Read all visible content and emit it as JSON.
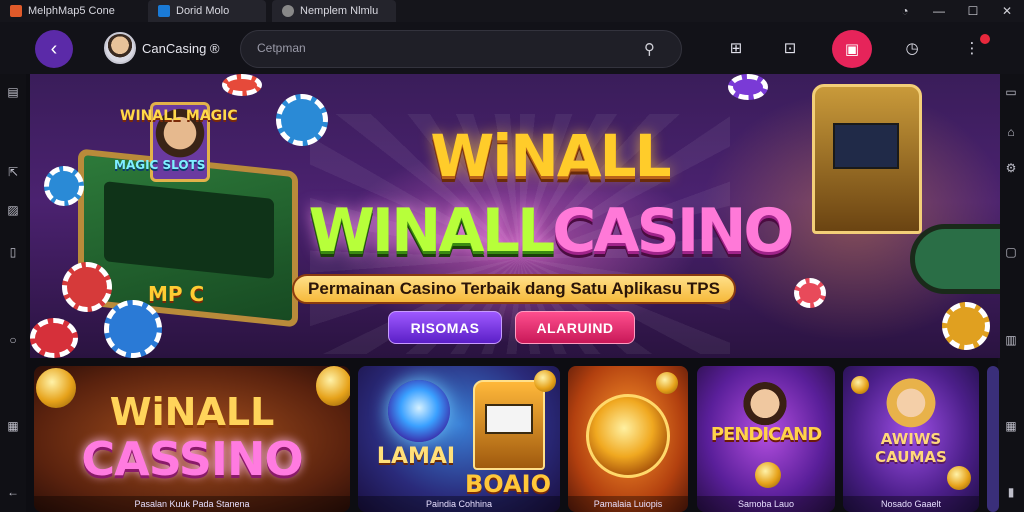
{
  "window": {
    "tabs": [
      {
        "label": "MelphMap5 Cone"
      },
      {
        "label": "Dorid   Molo"
      },
      {
        "label": "Nemplem Nlmlu"
      }
    ],
    "controls": [
      "◔",
      "—",
      "☐",
      "✕"
    ]
  },
  "toolbar": {
    "profile_name": "CanCasing ®",
    "search_placeholder": "Cetpman",
    "icons": [
      "back-icon",
      "search-icon",
      "plus-box-icon",
      "zoom-icon",
      "gift-icon",
      "timer-icon",
      "more-icon"
    ]
  },
  "hero": {
    "title_line1": "WiNALL",
    "title_line2_green": "WINALL",
    "title_line2_pink": "CASINO",
    "subtitle": "Permainan Casino Terbaik dang Satu Aplikasu TPS",
    "button1": "RISOMAS",
    "button2": "ALARUIND",
    "sign_left_top": "WINALL MAGIC",
    "sign_left_mid": "MAGIC SLOTS",
    "sign_left_bottom": "MP C"
  },
  "cards": [
    {
      "title_a": "WiNALL",
      "title_b": "CASSINO",
      "label": "Pasalan Kuuk Pada  Stanena"
    },
    {
      "title_a": "LAMAI",
      "title_b": "BOAIO",
      "label": "Paindia Cohhina"
    },
    {
      "title_a": "",
      "title_b": "",
      "label": "Pamalaia Luiopis"
    },
    {
      "title_a": "PENDICAND",
      "title_b": "",
      "label": "Samoba Lauo"
    },
    {
      "title_a": "AWIWS CAUMAS",
      "title_b": "",
      "label": "Nosado Gaaelt"
    }
  ],
  "colors": {
    "accent_purple": "#5b2aa8",
    "hot_pink": "#e6245a",
    "background": "#0d0d12"
  }
}
